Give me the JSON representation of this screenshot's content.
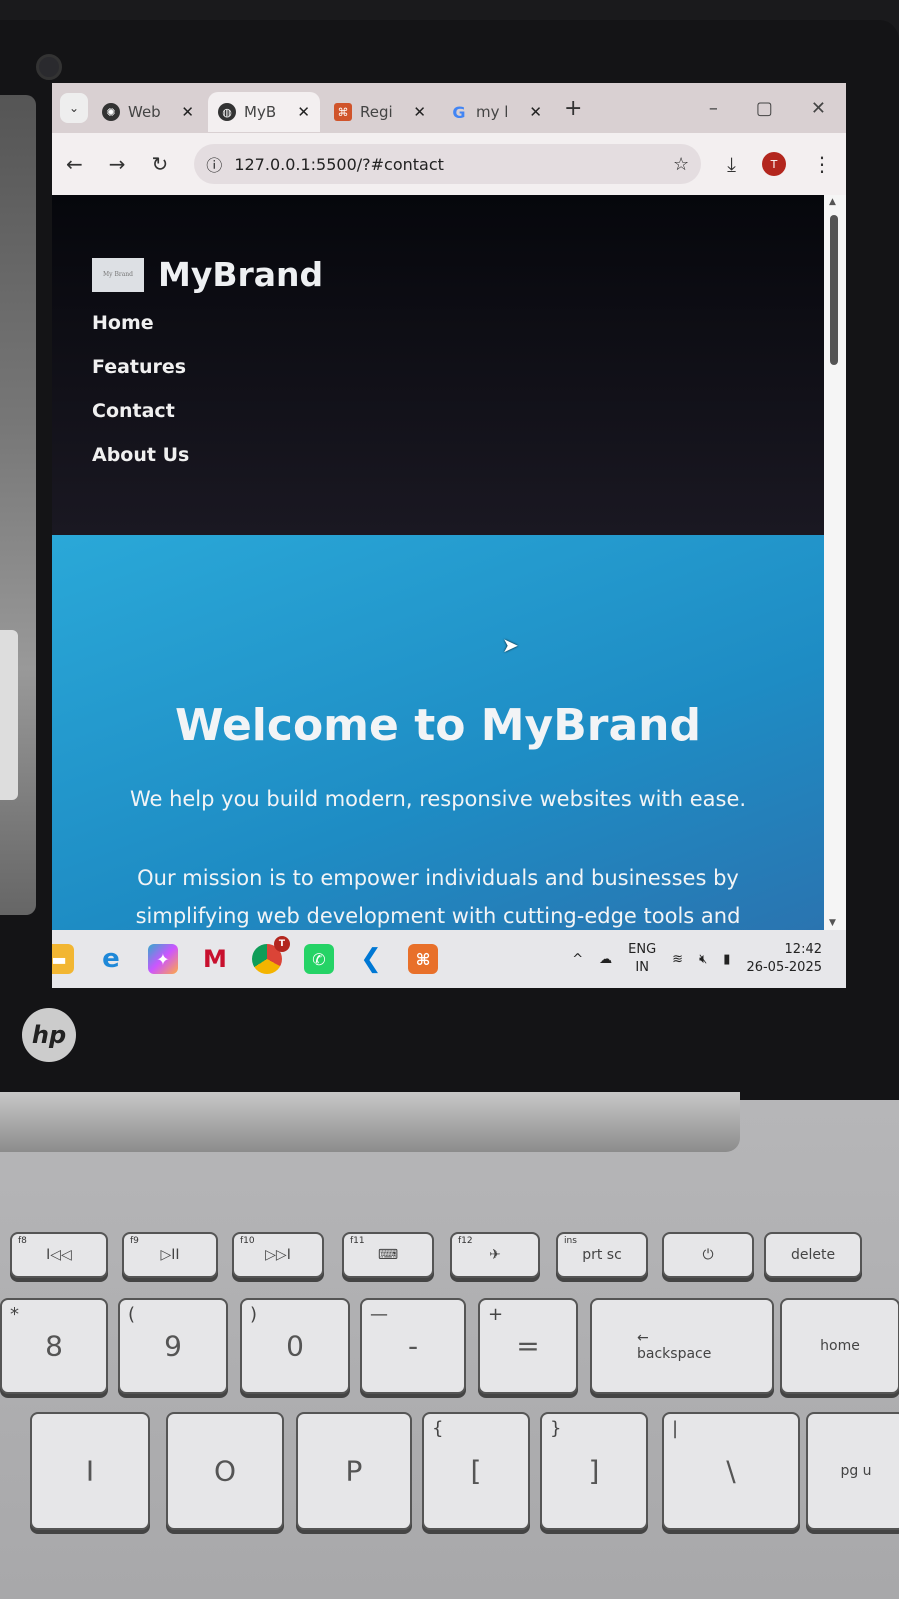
{
  "browser": {
    "tabs": [
      {
        "label": "Web",
        "icon": "chatgpt-icon",
        "active": false
      },
      {
        "label": "MyB",
        "icon": "globe-icon",
        "active": true
      },
      {
        "label": "Regi",
        "icon": "xampp-icon",
        "active": false
      },
      {
        "label": "my l",
        "icon": "google-icon",
        "active": false
      }
    ],
    "url": "127.0.0.1:5500/?#contact",
    "profile_initial": "T"
  },
  "site": {
    "logo_text": "My Brand",
    "brand": "MyBrand",
    "nav": [
      "Home",
      "Features",
      "Contact",
      "About Us"
    ],
    "hero_title": "Welcome to MyBrand",
    "hero_subtitle": "We help you build modern, responsive websites with ease.",
    "hero_mission": "Our mission is to empower individuals and businesses by simplifying web development with cutting-edge tools and"
  },
  "taskbar": {
    "apps": [
      "File Explorer",
      "Edge",
      "Copilot",
      "McAfee",
      "Chrome",
      "WhatsApp",
      "VS Code",
      "XAMPP"
    ],
    "chrome_badge": "T",
    "lang": "ENG",
    "region": "IN",
    "time": "12:42",
    "date": "26-05-2025"
  },
  "laptop": {
    "logo": "hp"
  },
  "keyboard": {
    "frow": [
      {
        "top": "f8",
        "label": "I◁◁"
      },
      {
        "top": "f9",
        "label": "▷II"
      },
      {
        "top": "f10",
        "label": "▷▷I"
      },
      {
        "top": "f11",
        "label": "⌨"
      },
      {
        "top": "f12",
        "label": "✈"
      },
      {
        "top": "ins",
        "label": "prt sc"
      },
      {
        "top": "",
        "label": "⏻"
      },
      {
        "top": "",
        "label": "delete"
      }
    ],
    "numrow": [
      {
        "shift": "*",
        "label": "8"
      },
      {
        "shift": "(",
        "label": "9"
      },
      {
        "shift": ")",
        "label": "0"
      },
      {
        "shift": "—",
        "label": "-"
      },
      {
        "shift": "+",
        "label": "="
      },
      {
        "shift": "",
        "label": "← backspace"
      },
      {
        "shift": "",
        "label": "home"
      }
    ],
    "toprow": [
      {
        "shift": "",
        "label": "I"
      },
      {
        "shift": "",
        "label": "O"
      },
      {
        "shift": "",
        "label": "P"
      },
      {
        "shift": "{",
        "label": "["
      },
      {
        "shift": "}",
        "label": "]"
      },
      {
        "shift": "|",
        "label": "\\"
      },
      {
        "shift": "",
        "label": "pg u"
      }
    ]
  }
}
